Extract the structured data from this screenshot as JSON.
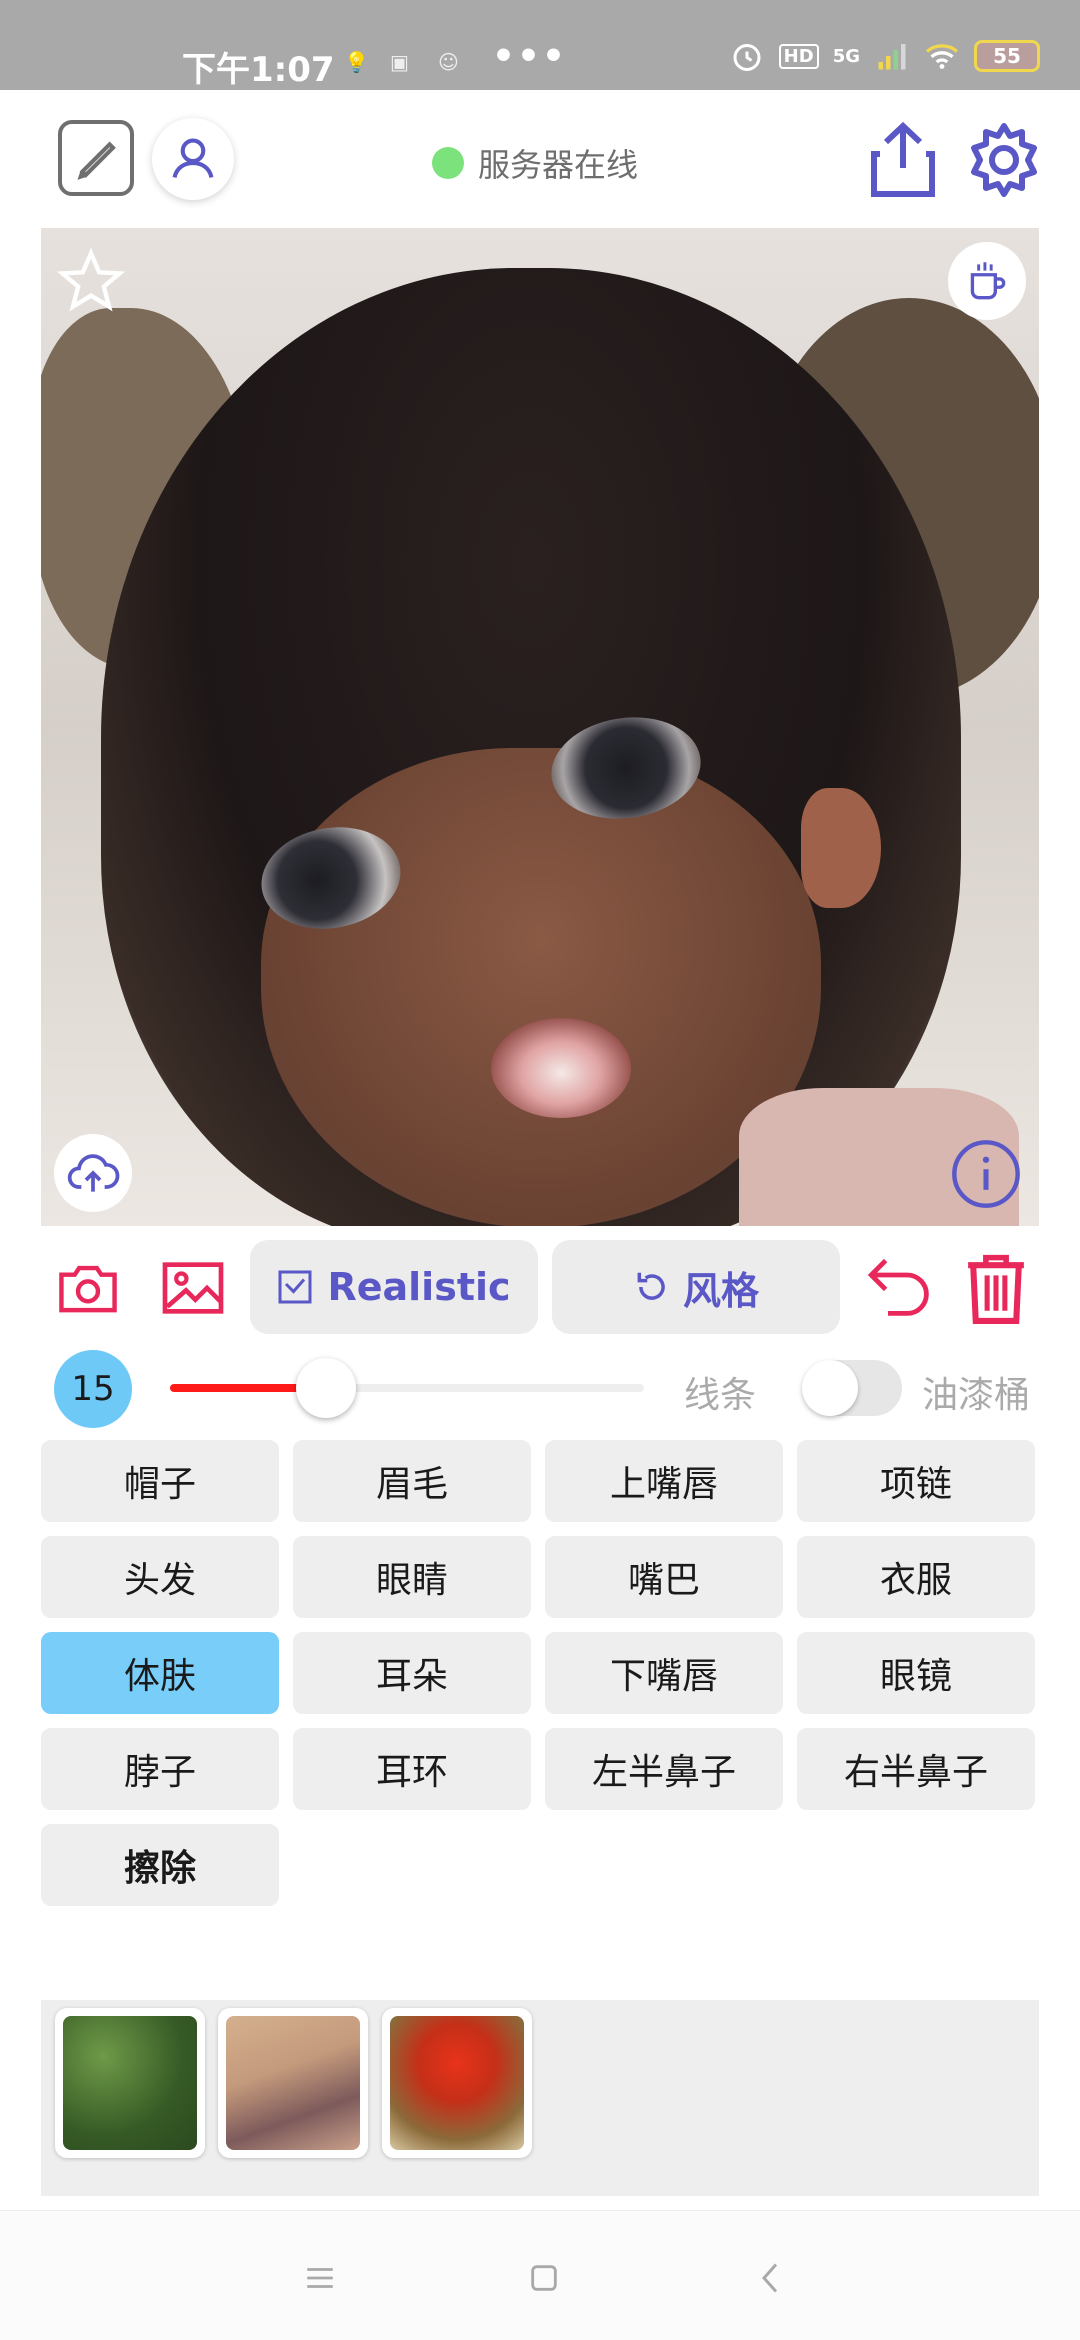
{
  "status_bar": {
    "time": "下午1:07",
    "dots": "•••",
    "network": "5G",
    "hd": "HD",
    "battery": "55"
  },
  "header": {
    "server_status": "服务器在线",
    "server_status_color": "#7ce27c"
  },
  "toolbar": {
    "realistic_label": "Realistic",
    "style_label": "风格",
    "accent_color": "#e8285a",
    "primary_color": "#5a58c6"
  },
  "brush": {
    "size": "15",
    "size_fraction": 0.33,
    "line_label": "线条",
    "bucket_label": "油漆桶",
    "bucket_enabled": false
  },
  "parts": [
    {
      "label": "帽子"
    },
    {
      "label": "眉毛"
    },
    {
      "label": "上嘴唇"
    },
    {
      "label": "项链"
    },
    {
      "label": "头发"
    },
    {
      "label": "眼睛"
    },
    {
      "label": "嘴巴"
    },
    {
      "label": "衣服"
    },
    {
      "label": "体肤",
      "active": true
    },
    {
      "label": "耳朵"
    },
    {
      "label": "下嘴唇"
    },
    {
      "label": "眼镜"
    },
    {
      "label": "脖子"
    },
    {
      "label": "耳环"
    },
    {
      "label": "左半鼻子"
    },
    {
      "label": "右半鼻子"
    },
    {
      "label": "擦除",
      "bold": true
    }
  ],
  "thumbnails": [
    "green-foliage",
    "beige-flowers",
    "red-tree"
  ]
}
